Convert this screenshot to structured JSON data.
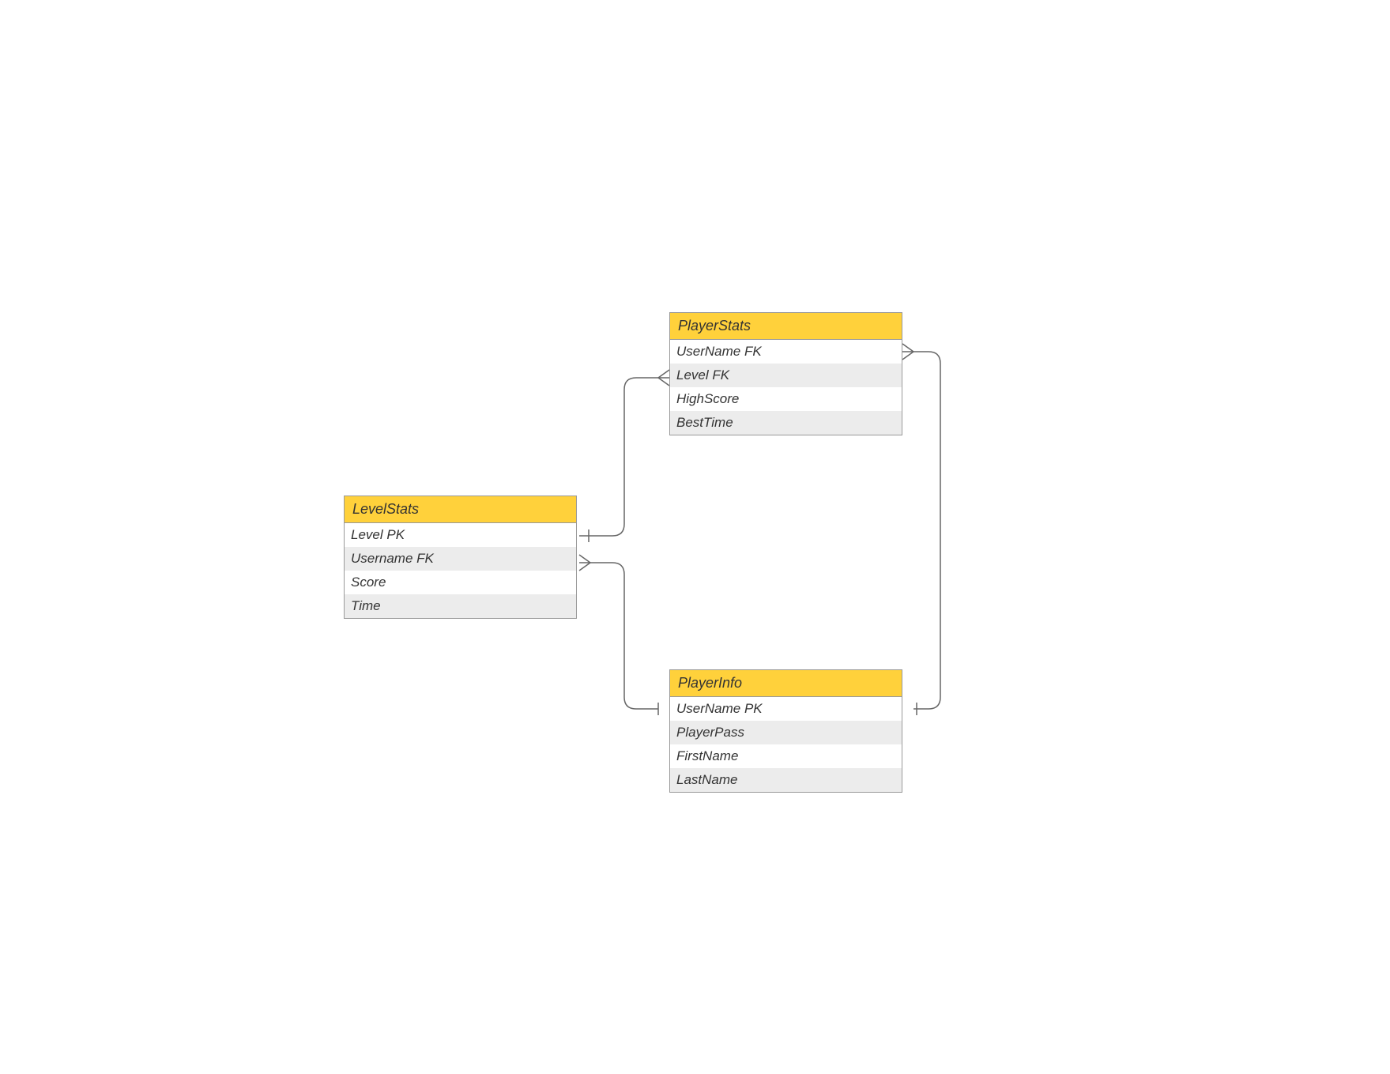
{
  "entities": {
    "levelStats": {
      "title": "LevelStats",
      "rows": [
        "Level PK",
        "Username FK",
        "Score",
        "Time"
      ]
    },
    "playerStats": {
      "title": "PlayerStats",
      "rows": [
        "UserName FK",
        "Level  FK",
        "HighScore",
        "BestTime"
      ]
    },
    "playerInfo": {
      "title": "PlayerInfo",
      "rows": [
        "UserName PK",
        "PlayerPass",
        "FirstName",
        "LastName"
      ]
    }
  }
}
